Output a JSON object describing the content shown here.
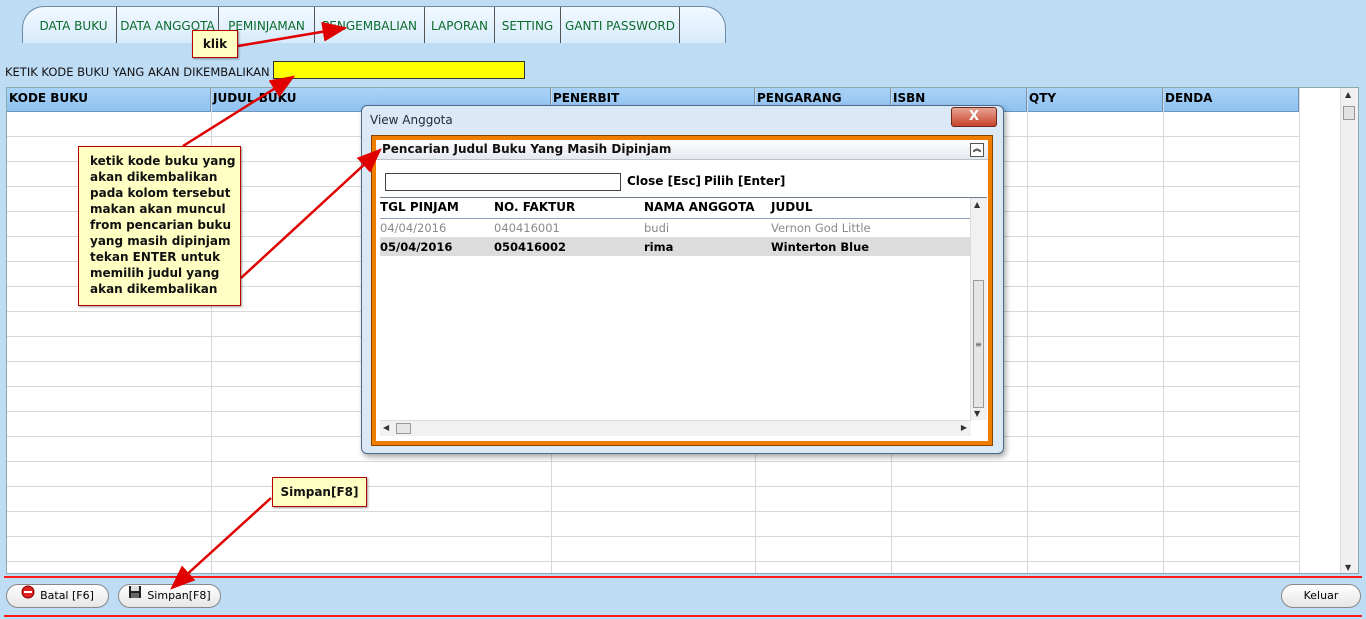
{
  "tabs": [
    "DATA BUKU",
    "DATA ANGGOTA",
    "PEMINJAMAN",
    "PENGEMBALIAN",
    "LAPORAN",
    "SETTING",
    "GANTI PASSWORD"
  ],
  "search": {
    "label": "KETIK KODE BUKU YANG AKAN DIKEMBALIKAN",
    "value": ""
  },
  "grid": {
    "columns": [
      "KODE BUKU",
      "JUDUL BUKU",
      "PENERBIT",
      "PENGARANG",
      "ISBN",
      "QTY",
      "DENDA"
    ]
  },
  "dialog": {
    "title": "View Anggota",
    "close_label": "X",
    "panel_title": "Pencarian Judul Buku Yang Masih Dipinjam",
    "search_value": "",
    "hint_close": "Close [Esc]",
    "hint_pick": "Pilih [Enter]",
    "columns": [
      "TGL PINJAM",
      "NO. FAKTUR",
      "NAMA ANGGOTA",
      "JUDUL"
    ],
    "rows": [
      {
        "tgl": "04/04/2016",
        "faktur": "040416001",
        "nama": "budi",
        "judul": "Vernon God Little"
      },
      {
        "tgl": "05/04/2016",
        "faktur": "050416002",
        "nama": "rima",
        "judul": "Winterton Blue"
      }
    ]
  },
  "buttons": {
    "batal": "Batal [F6]",
    "simpan": "Simpan[F8]",
    "keluar": "Keluar"
  },
  "annotations": {
    "klik": "klik",
    "simpan": "Simpan[F8]",
    "main_lines": [
      "ketik kode buku yang",
      "akan dikembalikan",
      "pada kolom tersebut",
      "makan akan muncul",
      "from pencarian buku",
      "yang masih dipinjam",
      "tekan ENTER untuk",
      "memilih judul yang",
      "akan dikembalikan"
    ],
    "accent_color": "#e00000"
  }
}
